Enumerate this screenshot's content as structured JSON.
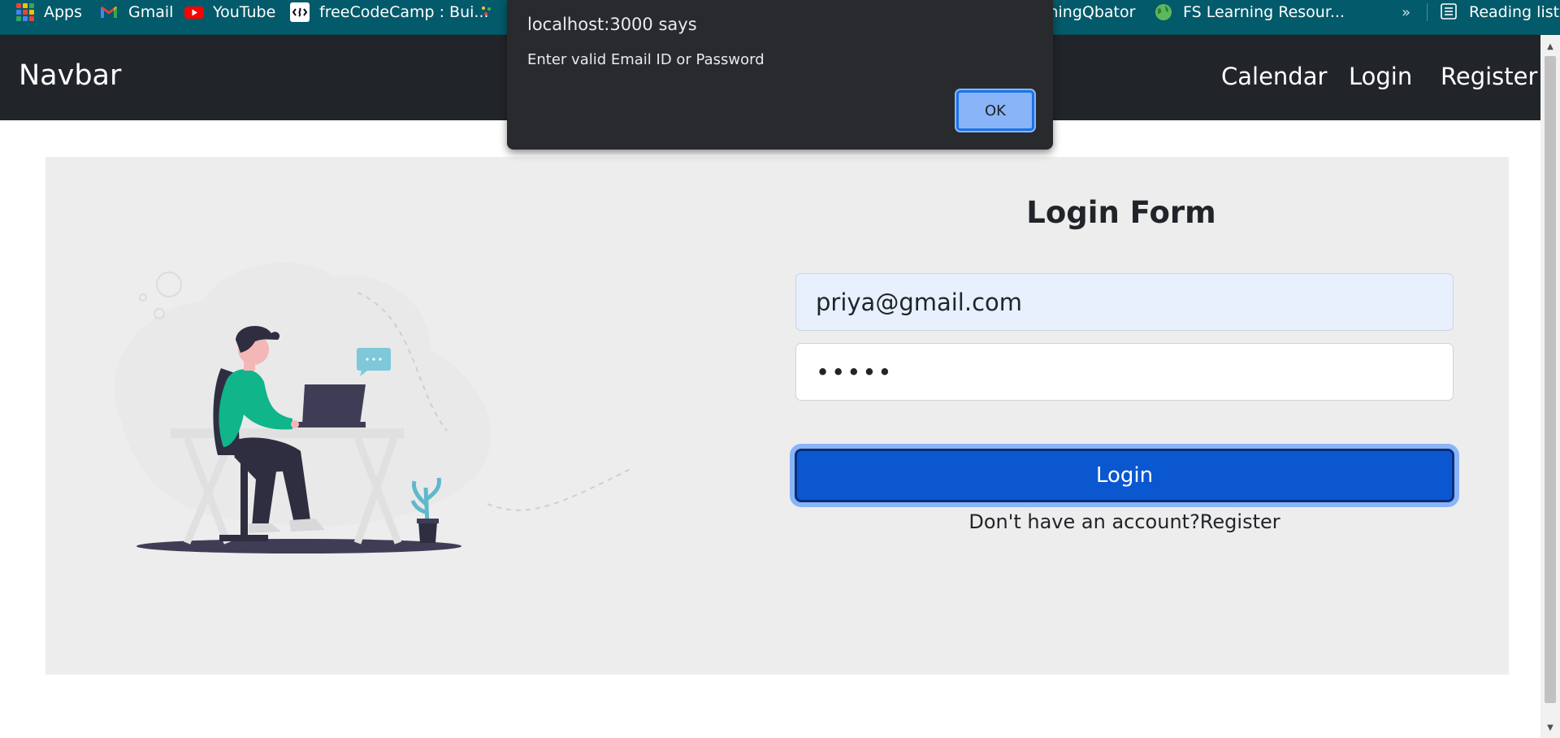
{
  "bookmarks": {
    "items": [
      {
        "label": "Apps",
        "icon": "apps-grid-icon"
      },
      {
        "label": "Gmail",
        "icon": "gmail-icon"
      },
      {
        "label": "YouTube",
        "icon": "youtube-icon"
      },
      {
        "label": "freeCodeCamp : Bui...",
        "icon": "freecodecamp-icon"
      },
      {
        "label": "thingQbator",
        "icon": ""
      },
      {
        "label": "FS Learning Resour...",
        "icon": "globe-icon"
      }
    ],
    "overflow": "»",
    "reading_list": "Reading list"
  },
  "navbar": {
    "brand": "Navbar",
    "links": [
      "Calendar",
      "Login",
      "Register"
    ]
  },
  "form": {
    "title": "Login Form",
    "email_value": "priya@gmail.com",
    "password_value": "•••••",
    "login_button": "Login",
    "register_prompt": "Don't have an account?Register"
  },
  "dialog": {
    "title": "localhost:3000 says",
    "message": "Enter valid Email ID or Password",
    "ok_label": "OK"
  },
  "colors": {
    "bookmark_bar": "#035a6a",
    "navbar": "#212529",
    "primary_button": "#0b57d0",
    "dialog_bg": "#292a2d",
    "dialog_button": "#8ab4f8"
  }
}
